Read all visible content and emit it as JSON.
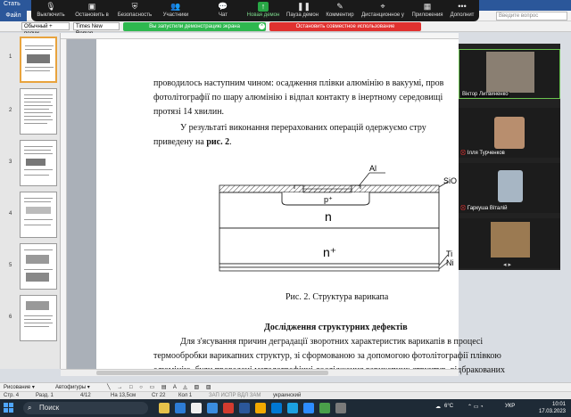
{
  "word": {
    "title": "Стать",
    "file_tab": "Файл",
    "ask_placeholder": "Введите вопрос",
    "style_value": "Обычный + полуж",
    "font_value": "Times New Roman",
    "demo_banner": "Вы запустили демонстрацию экрана",
    "stop_banner": "Остановить совместное использование"
  },
  "zoom_toolbar": {
    "buttons": [
      {
        "label": "Выключить",
        "icon": "mic-icon"
      },
      {
        "label": "Остановить в",
        "icon": "video-icon"
      },
      {
        "label": "Безопасность",
        "icon": "shield-icon"
      },
      {
        "label": "Участники",
        "icon": "participants-icon",
        "count": "3"
      },
      {
        "label": "Чат",
        "icon": "chat-icon"
      },
      {
        "label": "Новая демон",
        "icon": "share-icon"
      },
      {
        "label": "Пауза демон",
        "icon": "pause-icon"
      },
      {
        "label": "Комментир",
        "icon": "annotate-icon"
      },
      {
        "label": "Дистанционное у",
        "icon": "remote-control-icon"
      },
      {
        "label": "Приложения",
        "icon": "apps-icon"
      },
      {
        "label": "Дополнит",
        "icon": "more-icon"
      }
    ]
  },
  "document": {
    "para1_line1": "проводилось наступним чином: осадження плівки алюмінію в вакуумі, пров",
    "para1_line2": "фотолітографії по шару алюмінію і відпал контакту в інертному середовищі",
    "para1_line3": "протязі 14 хвилин.",
    "para2_line1": "У результаті виконання перерахованих операцій одержуємо стру",
    "para2_line2_pre": "приведену на ",
    "para2_line2_bold": "рис. 2",
    "para2_line2_post": ".",
    "caption": "Рис. 2. Структура варикапа",
    "heading": "Дослідження структурних дефектів",
    "para3_line1": "Для з'ясування причин деградації зворотних характеристик варикапів в процесі",
    "para3_line2": "термообробки варикапних структур, зі сформованою за допомогою фотолітографії плівкою",
    "para3_line3": "алюмінію, були проведені металографічні дослідження варикапних структур, відбракованих"
  },
  "figure": {
    "label_al": "Al",
    "label_sio2": "SiO",
    "label_p": "p⁺",
    "label_n": "n",
    "label_nplus": "n⁺",
    "label_ti": "Ti",
    "label_ni": "Ni"
  },
  "participants": [
    {
      "name": "Віктор Литвиненко",
      "muted": false
    },
    {
      "name": "Ілля Турченков",
      "muted": true
    },
    {
      "name": "Гаркуша Віталій",
      "muted": true
    },
    {
      "name": "",
      "muted": false
    }
  ],
  "thumbs": {
    "numbers": [
      "1",
      "2",
      "3",
      "4",
      "5",
      "6"
    ]
  },
  "drawbar": {
    "draw_label": "Рисование ▾",
    "autoshapes_label": "Автофигуры ▾"
  },
  "status": {
    "page": "Стр. 4",
    "section": "Разд. 1",
    "pages": "4/12",
    "at": "На 13,5см",
    "line": "Ст 22",
    "col": "Кол 1",
    "modes": "ЗАП  ИСПР  ВДЛ  ЗАМ",
    "lang": "украинский"
  },
  "taskbar": {
    "search_label": "Поиск",
    "weather": "6°C",
    "lang": "УКР",
    "time": "10:01",
    "date": "17.03.2023"
  }
}
